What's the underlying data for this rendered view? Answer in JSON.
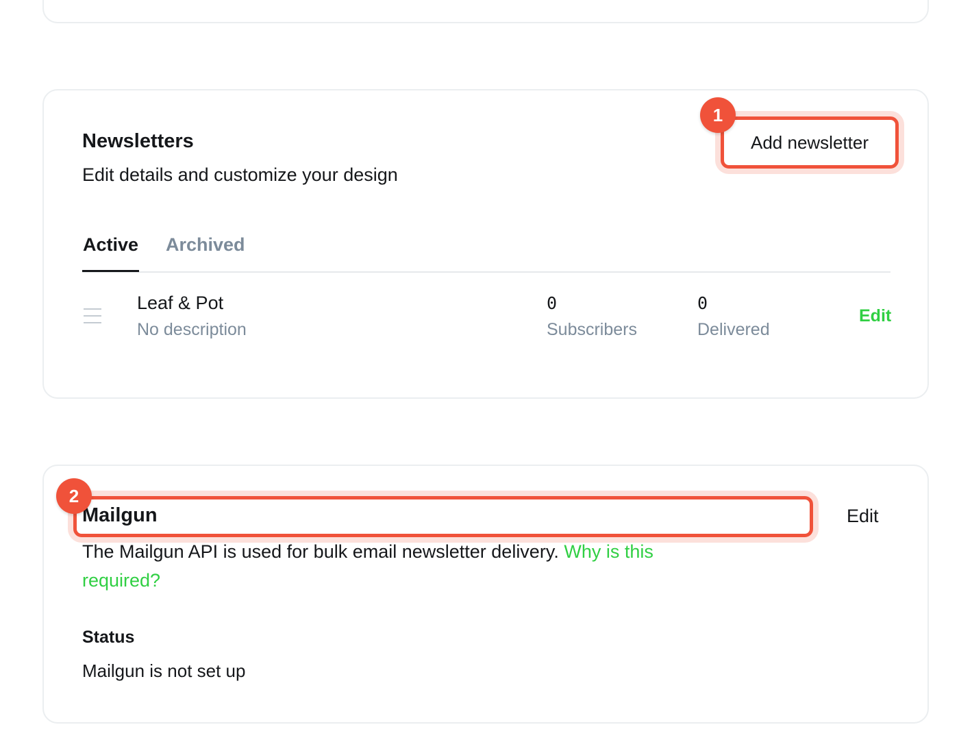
{
  "newsletters": {
    "title": "Newsletters",
    "description": "Edit details and customize your design",
    "add_button_label": "Add newsletter",
    "badge_label": "1",
    "tabs": [
      {
        "label": "Active",
        "selected": true
      },
      {
        "label": "Archived",
        "selected": false
      }
    ],
    "rows": [
      {
        "name": "Leaf & Pot",
        "description": "No description",
        "subscribers_value": "0",
        "subscribers_label": "Subscribers",
        "delivered_value": "0",
        "delivered_label": "Delivered",
        "edit_label": "Edit"
      }
    ]
  },
  "mailgun": {
    "title": "Mailgun",
    "badge_label": "2",
    "edit_label": "Edit",
    "description": "The Mailgun API is used for bulk email newsletter delivery.",
    "help_link": "Why is this required?",
    "status_title": "Status",
    "status_text": "Mailgun is not set up"
  },
  "colors": {
    "accent_green": "#30cf43",
    "highlight_red": "#f0523a",
    "muted_text": "#7c8b9a",
    "border": "#ebeef0"
  },
  "icons": {
    "drag_handle": "drag-handle-icon"
  }
}
